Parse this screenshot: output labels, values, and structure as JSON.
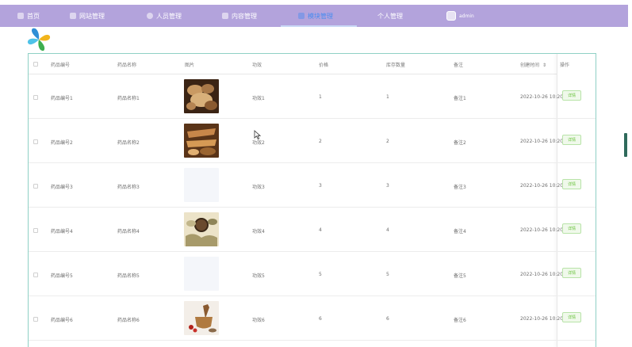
{
  "nav": {
    "items": [
      {
        "label": "首页",
        "icon": "home-icon"
      },
      {
        "label": "网站管理",
        "icon": "grid-icon"
      },
      {
        "label": "人员管理",
        "icon": "person-icon"
      },
      {
        "label": "内容管理",
        "icon": "document-icon"
      },
      {
        "label": "模块管理",
        "icon": "module-icon",
        "active": true
      },
      {
        "label": "个人管理",
        "icon": ""
      }
    ],
    "user": "admin"
  },
  "table": {
    "headers": [
      "药品编号",
      "药品名称",
      "图片",
      "功效",
      "价格",
      "库存数量",
      "备注",
      "创建时间",
      "操作"
    ],
    "sort_icon": "⇕",
    "action_label": "详情",
    "rows": [
      {
        "code": "药品编号1",
        "name": "药品名称1",
        "effect": "功效1",
        "price": "1",
        "stock": "1",
        "note": "备注1",
        "created": "2022-10-26 10:20",
        "image": "brown"
      },
      {
        "code": "药品编号2",
        "name": "药品名称2",
        "effect": "功效2",
        "price": "2",
        "stock": "2",
        "note": "备注2",
        "created": "2022-10-26 10:20",
        "image": "amber"
      },
      {
        "code": "药品编号3",
        "name": "药品名称3",
        "effect": "功效3",
        "price": "3",
        "stock": "3",
        "note": "备注3",
        "created": "2022-10-26 10:20",
        "image": "none"
      },
      {
        "code": "药品编号4",
        "name": "药品名称4",
        "effect": "功效4",
        "price": "4",
        "stock": "4",
        "note": "备注4",
        "created": "2022-10-26 10:20",
        "image": "tea"
      },
      {
        "code": "药品编号5",
        "name": "药品名称5",
        "effect": "功效5",
        "price": "5",
        "stock": "5",
        "note": "备注5",
        "created": "2022-10-26 10:20",
        "image": "none"
      },
      {
        "code": "药品编号6",
        "name": "药品名称6",
        "effect": "功效6",
        "price": "6",
        "stock": "6",
        "note": "备注6",
        "created": "2022-10-26 10:20",
        "image": "mortar"
      }
    ]
  },
  "colors": {
    "topbar": "#b3a3dc",
    "active_nav": "#4a8cf0",
    "table_border": "#8fd0c5",
    "detail_button": "#67c23a"
  }
}
